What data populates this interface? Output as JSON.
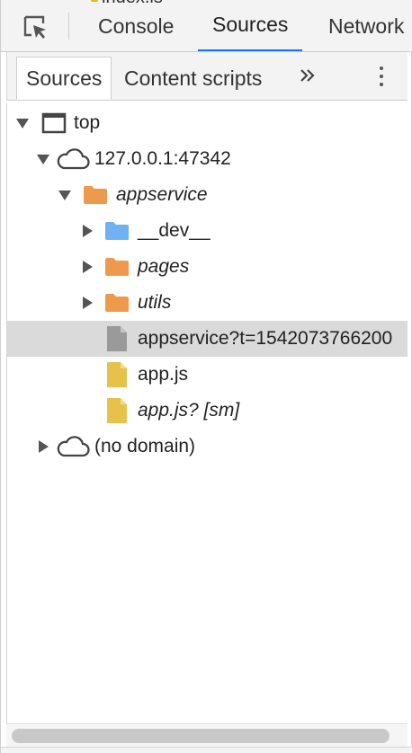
{
  "topbar": {
    "peek_text": "index.is",
    "tabs": [
      {
        "label": "Console"
      },
      {
        "label": "Sources"
      },
      {
        "label": "Network"
      }
    ]
  },
  "navigator": {
    "tabs": [
      {
        "label": "Sources"
      },
      {
        "label": "Content scripts"
      }
    ],
    "more_glyph": "»"
  },
  "tree": {
    "top": "top",
    "host": "127.0.0.1:47342",
    "appservice_folder": "appservice",
    "dev_folder": "__dev__",
    "pages_folder": "pages",
    "utils_folder": "utils",
    "appservice_file": "appservice?t=1542073766200",
    "appjs": "app.js",
    "appjs_sm": "app.js? [sm]",
    "no_domain": "(no domain)"
  },
  "colors": {
    "accent": "#1a73e8",
    "folder_orange": "#ee9a4d",
    "folder_blue": "#6fb1f3",
    "file_yellow": "#e6c24a",
    "file_gray": "#9a9a9a",
    "selected_row": "#dadada"
  },
  "icons": {
    "inspect": "inspect-element-icon",
    "more_tabs": "chevron-double-right-icon",
    "menu": "more-vertical-icon",
    "frame": "frame-window-icon",
    "cloud": "cloud-icon",
    "folder": "folder-icon",
    "file": "file-icon"
  }
}
